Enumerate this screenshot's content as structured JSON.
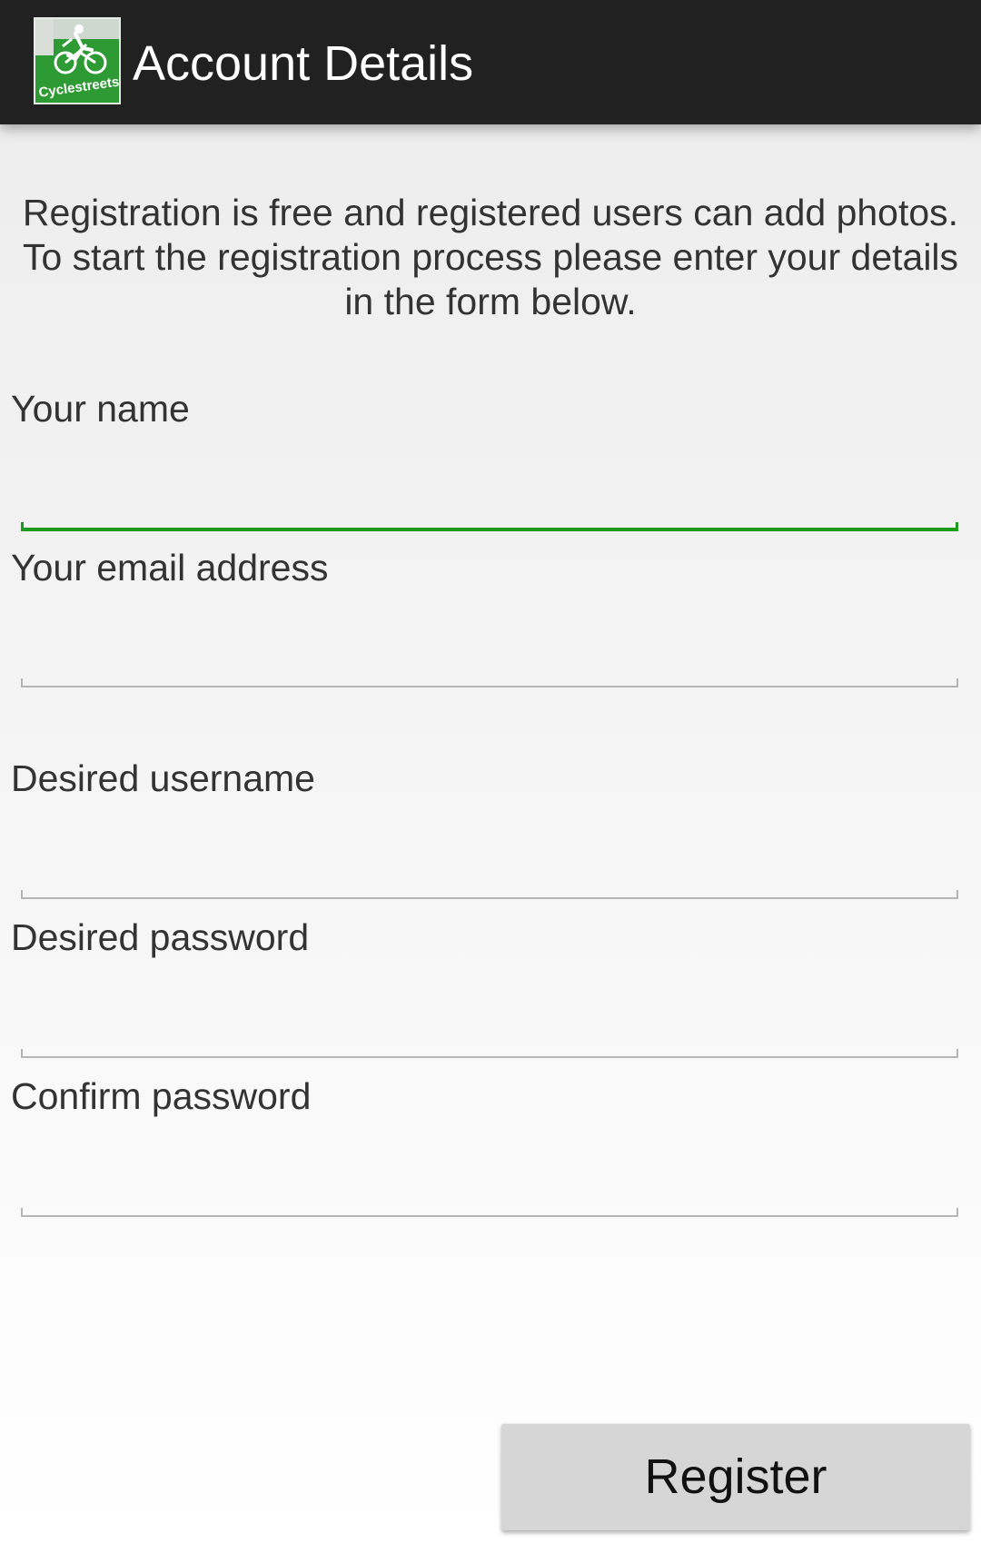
{
  "appbar": {
    "title": "Account Details",
    "icon_name": "cyclestreets-app-icon",
    "icon_text": "Cyclestreets"
  },
  "intro_text": "Registration is free and registered users can add photos. To start the registration process please enter your details in the form below.",
  "form": {
    "name": {
      "label": "Your name",
      "value": "",
      "focused": true
    },
    "email": {
      "label": "Your email address",
      "value": ""
    },
    "username": {
      "label": "Desired username",
      "value": ""
    },
    "password": {
      "label": "Desired password",
      "value": ""
    },
    "confirm_password": {
      "label": "Confirm password",
      "value": ""
    }
  },
  "register_label": "Register",
  "colors": {
    "appbar": "#212121",
    "focus_accent": "#1c9b1c",
    "brand_green": "#2e9a34",
    "button": "#d6d6d6"
  }
}
